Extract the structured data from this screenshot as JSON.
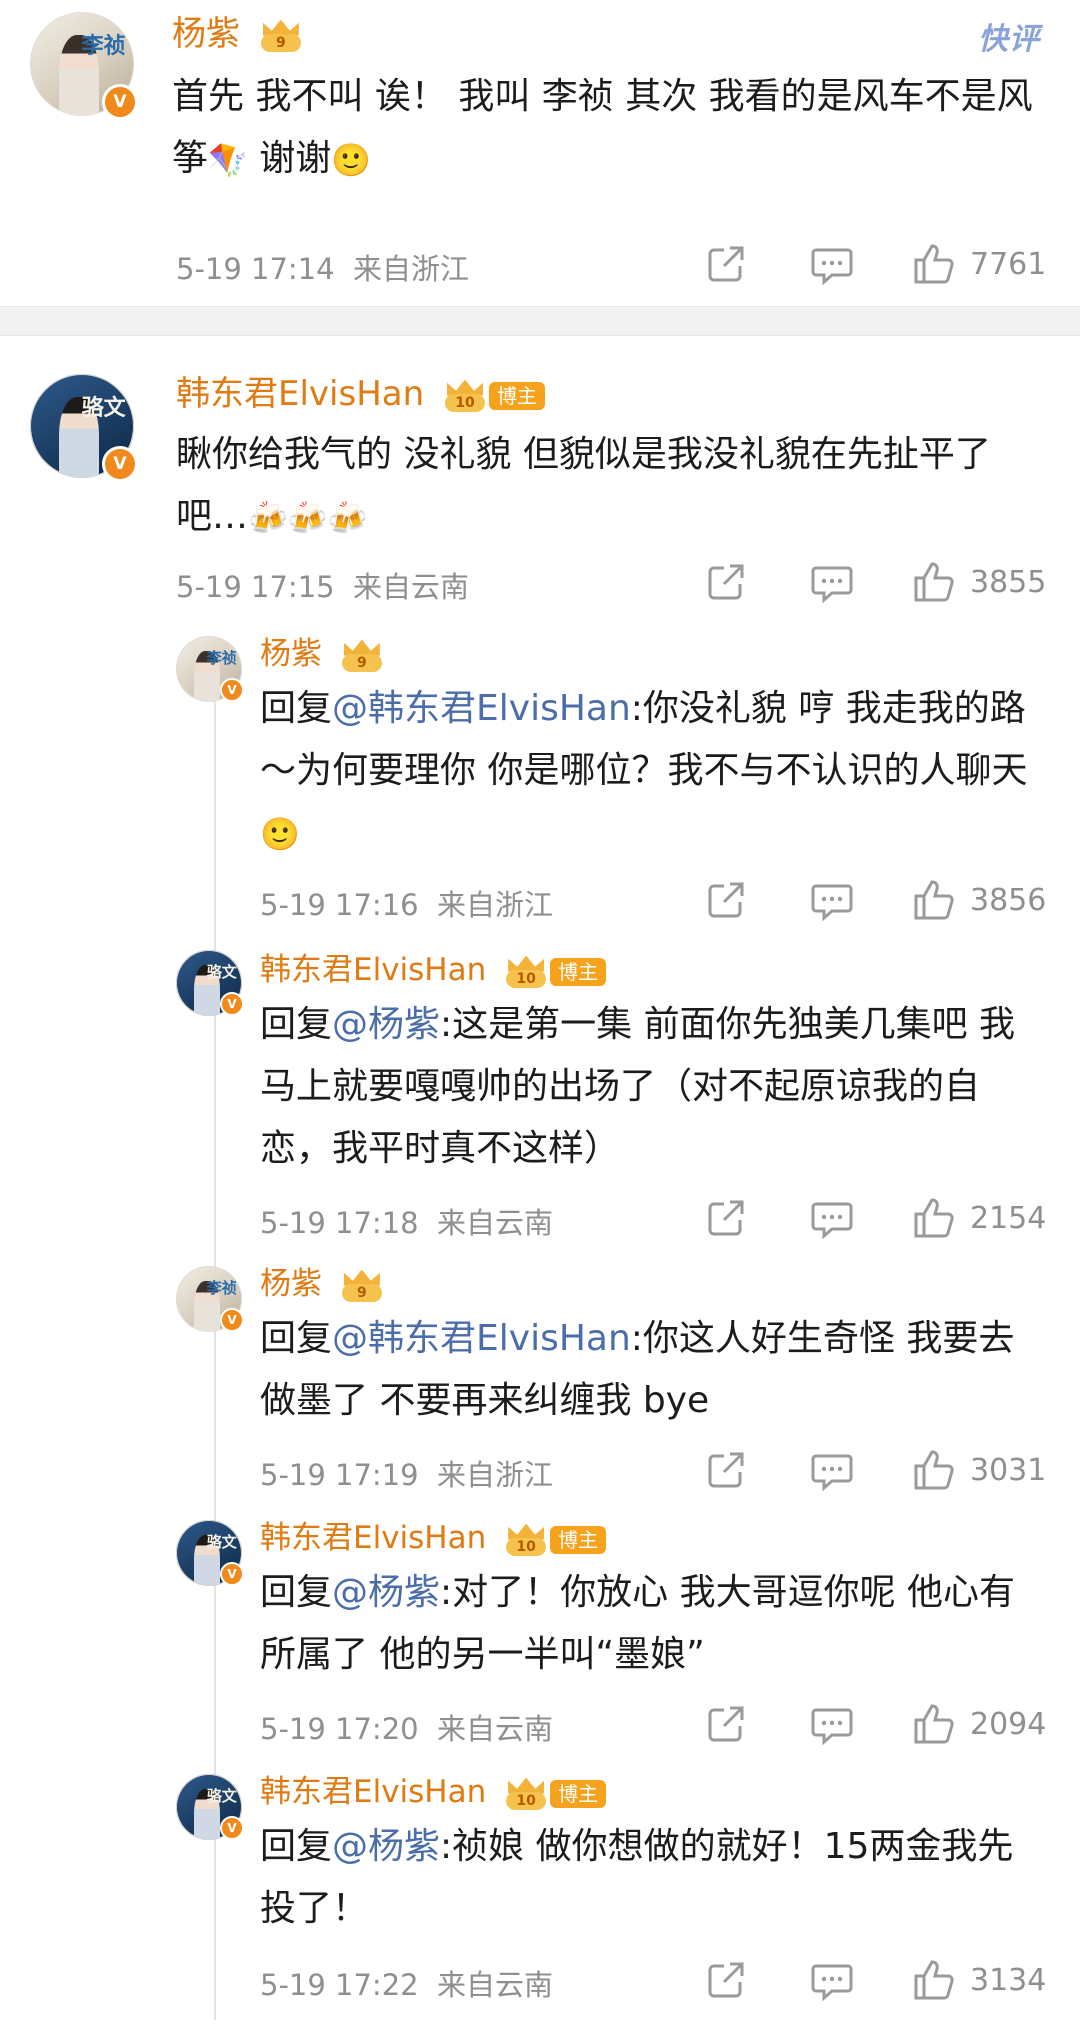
{
  "platform_badge": "快评",
  "comments": [
    {
      "user": "杨紫",
      "crown_level": "9",
      "avatar_text": "李祯",
      "text_parts": [
        "首先 我不叫 诶！ 我叫 李祯 其次 我看的是风车不是风筝",
        " 谢谢"
      ],
      "emojis": [
        "🪁",
        "🙂"
      ],
      "time": "5-19 17:14",
      "location": "来自浙江",
      "likes": "7761"
    },
    {
      "user": "韩东君ElvisHan",
      "crown_level": "10",
      "badge": "博主",
      "avatar_text": "骆文",
      "text": "瞅你给我气的  没礼貌   但貌似是我没礼貌在先扯平了吧…",
      "emoji_string": "🍻🍻🍻",
      "time": "5-19 17:15",
      "location": "来自云南",
      "likes": "3855"
    }
  ],
  "replies": [
    {
      "user": "杨紫",
      "crown_level": "9",
      "avatar_text": "李祯",
      "prefix": "回复",
      "mention": "@韩东君ElvisHan",
      "text": ":你没礼貌 哼 我走我的路～为何要理你 你是哪位？我不与不认识的人聊天",
      "emoji": "🙂",
      "time": "5-19 17:16",
      "location": "来自浙江",
      "likes": "3856"
    },
    {
      "user": "韩东君ElvisHan",
      "crown_level": "10",
      "badge": "博主",
      "avatar_text": "骆文",
      "prefix": "回复",
      "mention": "@杨紫",
      "text": ":这是第一集  前面你先独美几集吧   我马上就要嘎嘎帅的出场了（对不起原谅我的自恋，我平时真不这样）",
      "time": "5-19 17:18",
      "location": "来自云南",
      "likes": "2154"
    },
    {
      "user": "杨紫",
      "crown_level": "9",
      "avatar_text": "李祯",
      "prefix": "回复",
      "mention": "@韩东君ElvisHan",
      "text": ":你这人好生奇怪 我要去做墨了 不要再来纠缠我 bye",
      "time": "5-19 17:19",
      "location": "来自浙江",
      "likes": "3031"
    },
    {
      "user": "韩东君ElvisHan",
      "crown_level": "10",
      "badge": "博主",
      "avatar_text": "骆文",
      "prefix": "回复",
      "mention": "@杨紫",
      "text": ":对了！你放心 我大哥逗你呢  他心有所属了  他的另一半叫“墨娘”",
      "time": "5-19 17:20",
      "location": "来自云南",
      "likes": "2094"
    },
    {
      "user": "韩东君ElvisHan",
      "crown_level": "10",
      "badge": "博主",
      "avatar_text": "骆文",
      "prefix": "回复",
      "mention": "@杨紫",
      "text": ":祯娘  做你想做的就好！15两金我先投了！",
      "time": "5-19 17:22",
      "location": "来自云南",
      "likes": "3134"
    }
  ],
  "colors": {
    "username": "#e07b13",
    "mention": "#4b6ea8",
    "meta": "#8f8f8f",
    "badge": "#f7a21c"
  },
  "icons": [
    "share-icon",
    "comment-icon",
    "like-icon",
    "verified-icon",
    "crown-icon"
  ]
}
